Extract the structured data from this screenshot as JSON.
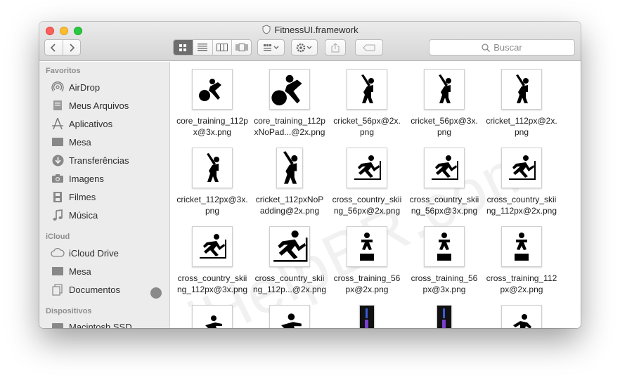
{
  "window": {
    "title": "FitnessUI.framework"
  },
  "toolbar": {
    "back_icon": "chevron-left-icon",
    "forward_icon": "chevron-right-icon",
    "view_modes": [
      "icon-view",
      "list-view",
      "column-view",
      "cover-flow-view"
    ],
    "active_view": "icon-view",
    "search_placeholder": "Buscar"
  },
  "sidebar": {
    "sections": [
      {
        "header": "Favoritos",
        "items": [
          {
            "label": "AirDrop",
            "icon": "airdrop-icon"
          },
          {
            "label": "Meus Arquivos",
            "icon": "all-files-icon"
          },
          {
            "label": "Aplicativos",
            "icon": "applications-icon"
          },
          {
            "label": "Mesa",
            "icon": "desktop-icon"
          },
          {
            "label": "Transferências",
            "icon": "downloads-icon"
          },
          {
            "label": "Imagens",
            "icon": "camera-icon"
          },
          {
            "label": "Filmes",
            "icon": "film-icon"
          },
          {
            "label": "Música",
            "icon": "music-note-icon"
          }
        ]
      },
      {
        "header": "iCloud",
        "items": [
          {
            "label": "iCloud Drive",
            "icon": "cloud-icon"
          },
          {
            "label": "Mesa",
            "icon": "desktop-icon"
          },
          {
            "label": "Documentos",
            "icon": "documents-icon"
          }
        ]
      },
      {
        "header": "Dispositivos",
        "items": [
          {
            "label": "Macintosh SSD",
            "icon": "disk-icon"
          }
        ]
      }
    ]
  },
  "files": [
    {
      "name": "core_training_112p\nx@3x.png",
      "icon": "core-training-icon"
    },
    {
      "name": "core_training_112p\nxNoPad...@2x.png",
      "icon": "core-training-icon"
    },
    {
      "name": "cricket_56px@2x.\npng",
      "icon": "cricket-icon"
    },
    {
      "name": "cricket_56px@3x.\npng",
      "icon": "cricket-icon"
    },
    {
      "name": "cricket_112px@2x.\npng",
      "icon": "cricket-icon"
    },
    {
      "name": "cricket_112px@3x.\npng",
      "icon": "cricket-icon"
    },
    {
      "name": "cricket_112pxNoP\nadding@2x.png",
      "icon": "cricket-icon"
    },
    {
      "name": "cross_country_skii\nng_56px@2x.png",
      "icon": "cross-country-skiing-icon"
    },
    {
      "name": "cross_country_skii\nng_56px@3x.png",
      "icon": "cross-country-skiing-icon"
    },
    {
      "name": "cross_country_skii\nng_112px@2x.png",
      "icon": "cross-country-skiing-icon"
    },
    {
      "name": "cross_country_skii\nng_112px@3x.png",
      "icon": "cross-country-skiing-icon"
    },
    {
      "name": "cross_country_skii\nng_112p...@2x.png",
      "icon": "cross-country-skiing-icon"
    },
    {
      "name": "cross_training_56\npx@2x.png",
      "icon": "cross-training-icon"
    },
    {
      "name": "cross_training_56\npx@3x.png",
      "icon": "cross-training-icon"
    },
    {
      "name": "cross_training_112\npx@2x.png",
      "icon": "cross-training-icon"
    },
    {
      "name": "",
      "icon": "squat-icon"
    },
    {
      "name": "",
      "icon": "squat-icon"
    },
    {
      "name": "",
      "icon": "dance-image-icon"
    },
    {
      "name": "",
      "icon": "dance-image-icon"
    },
    {
      "name": "",
      "icon": "skating-icon"
    }
  ],
  "watermark": "iHelpBR.com"
}
